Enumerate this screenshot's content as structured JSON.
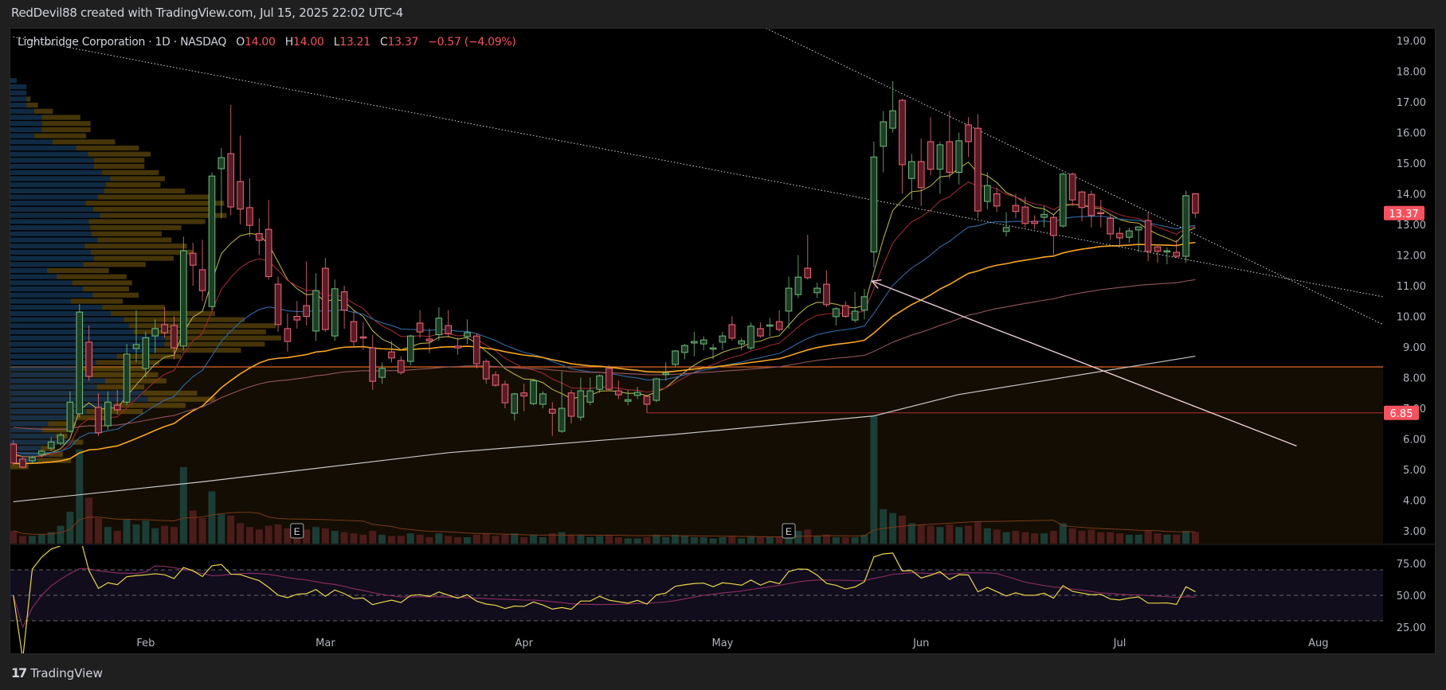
{
  "header": {
    "attribution": "RedDevil88 created with TradingView.com, Jul 15, 2025 22:02 UTC-4"
  },
  "legend": {
    "symbol": "Lightbridge Corporation · 1D · NASDAQ",
    "open_label": "O",
    "open": "14.00",
    "high_label": "H",
    "high": "14.00",
    "low_label": "L",
    "low": "13.21",
    "close_label": "C",
    "close": "13.37",
    "change": "−0.57 (−4.09%)"
  },
  "footer": {
    "logo_mark": "17",
    "brand": "TradingView"
  },
  "price_axis": [
    "19.00",
    "18.00",
    "17.00",
    "16.00",
    "15.00",
    "14.00",
    "13.00",
    "12.00",
    "11.00",
    "10.00",
    "9.00",
    "8.00",
    "7.00",
    "6.00",
    "5.00",
    "4.00",
    "3.00"
  ],
  "rsi_axis": [
    "75.00",
    "50.00",
    "25.00"
  ],
  "time_axis": [
    {
      "label": "Feb",
      "index": 14
    },
    {
      "label": "Mar",
      "index": 33
    },
    {
      "label": "Apr",
      "index": 54
    },
    {
      "label": "May",
      "index": 75
    },
    {
      "label": "Jun",
      "index": 96
    },
    {
      "label": "Jul",
      "index": 117
    },
    {
      "label": "Aug",
      "index": 138
    }
  ],
  "badges": {
    "last_price": "13.37",
    "level": "6.85"
  },
  "earnings_markers": [
    {
      "label": "E",
      "index": 30
    },
    {
      "label": "E",
      "index": 82
    }
  ],
  "colors": {
    "up": "#6fbf7b",
    "down": "#f06b7b",
    "badge": "#f7525f",
    "level_orange": "#e0662a",
    "level_red": "#b03030"
  },
  "chart_data": {
    "type": "candlestick",
    "title": "Lightbridge Corporation · 1D · NASDAQ",
    "ylim": [
      2.7,
      19.85
    ],
    "rsi_ylim": [
      0,
      100
    ],
    "ohlc": [
      [
        5.83,
        5.95,
        5.15,
        5.21
      ],
      [
        5.34,
        5.4,
        5.05,
        5.08
      ],
      [
        5.29,
        5.45,
        5.2,
        5.39
      ],
      [
        5.5,
        5.65,
        5.4,
        5.6
      ],
      [
        5.7,
        6.05,
        5.6,
        5.9
      ],
      [
        5.86,
        6.2,
        5.8,
        6.12
      ],
      [
        6.25,
        7.55,
        6.2,
        7.2
      ],
      [
        6.82,
        10.4,
        6.7,
        10.14
      ],
      [
        9.16,
        9.7,
        7.9,
        8.04
      ],
      [
        7.03,
        7.5,
        6.1,
        6.2
      ],
      [
        6.43,
        7.55,
        6.3,
        7.2
      ],
      [
        7.1,
        7.6,
        6.8,
        6.95
      ],
      [
        7.2,
        9.1,
        7.1,
        8.77
      ],
      [
        8.95,
        10.2,
        8.5,
        9.08
      ],
      [
        8.3,
        9.5,
        8.0,
        9.3
      ],
      [
        9.36,
        9.9,
        8.8,
        9.6
      ],
      [
        9.73,
        10.3,
        9.3,
        9.47
      ],
      [
        9.7,
        10.0,
        8.6,
        8.97
      ],
      [
        9.03,
        12.6,
        8.9,
        12.14
      ],
      [
        12.06,
        12.4,
        11.0,
        11.67
      ],
      [
        11.52,
        12.5,
        10.5,
        10.84
      ],
      [
        10.32,
        14.7,
        10.2,
        14.58
      ],
      [
        14.82,
        15.5,
        13.2,
        15.18
      ],
      [
        15.31,
        16.9,
        13.3,
        13.57
      ],
      [
        14.4,
        15.9,
        13.0,
        13.5
      ],
      [
        13.55,
        14.5,
        12.6,
        12.97
      ],
      [
        12.7,
        13.2,
        12.0,
        12.48
      ],
      [
        12.84,
        13.8,
        11.2,
        11.3
      ],
      [
        11.05,
        11.3,
        9.5,
        9.73
      ],
      [
        9.6,
        10.1,
        8.85,
        9.18
      ],
      [
        10.0,
        10.5,
        9.6,
        9.88
      ],
      [
        10.35,
        11.8,
        9.7,
        10.0
      ],
      [
        9.52,
        11.4,
        9.2,
        10.84
      ],
      [
        11.57,
        11.9,
        9.5,
        9.57
      ],
      [
        9.36,
        11.2,
        9.2,
        10.9
      ],
      [
        10.8,
        11.0,
        9.6,
        10.2
      ],
      [
        9.83,
        10.2,
        9.0,
        9.18
      ],
      [
        9.33,
        9.8,
        8.9,
        9.3
      ],
      [
        8.97,
        9.4,
        7.6,
        7.88
      ],
      [
        8.01,
        8.5,
        7.8,
        8.3
      ],
      [
        8.84,
        9.2,
        8.5,
        8.64
      ],
      [
        8.56,
        8.7,
        8.1,
        8.17
      ],
      [
        8.53,
        9.4,
        8.4,
        9.36
      ],
      [
        9.78,
        10.2,
        9.3,
        9.49
      ],
      [
        9.26,
        9.6,
        8.8,
        9.2
      ],
      [
        9.4,
        10.3,
        9.2,
        9.94
      ],
      [
        9.7,
        10.2,
        9.3,
        9.44
      ],
      [
        9.03,
        9.3,
        8.75,
        8.97
      ],
      [
        9.34,
        9.9,
        9.1,
        9.47
      ],
      [
        9.36,
        9.45,
        8.3,
        8.45
      ],
      [
        8.53,
        8.6,
        7.8,
        7.96
      ],
      [
        8.09,
        8.2,
        7.7,
        7.75
      ],
      [
        7.78,
        7.9,
        7.0,
        7.18
      ],
      [
        6.84,
        7.5,
        6.6,
        7.47
      ],
      [
        7.5,
        7.8,
        6.9,
        7.4
      ],
      [
        7.15,
        7.95,
        7.1,
        7.9
      ],
      [
        7.13,
        7.55,
        7.0,
        7.47
      ],
      [
        6.97,
        7.2,
        6.1,
        6.84
      ],
      [
        6.25,
        8.2,
        6.2,
        7.0
      ],
      [
        7.5,
        7.6,
        6.5,
        6.74
      ],
      [
        6.71,
        8.0,
        6.6,
        7.57
      ],
      [
        7.2,
        8.0,
        7.1,
        7.57
      ],
      [
        7.62,
        8.1,
        7.5,
        8.06
      ],
      [
        8.3,
        8.4,
        7.6,
        7.62
      ],
      [
        7.57,
        7.9,
        7.3,
        7.44
      ],
      [
        7.23,
        7.6,
        7.1,
        7.28
      ],
      [
        7.42,
        7.7,
        7.3,
        7.52
      ],
      [
        7.39,
        7.4,
        6.85,
        7.13
      ],
      [
        7.26,
        8.0,
        7.2,
        7.96
      ],
      [
        8.1,
        8.5,
        7.9,
        8.15
      ],
      [
        8.43,
        8.9,
        8.35,
        8.87
      ],
      [
        8.82,
        9.1,
        8.6,
        9.05
      ],
      [
        9.13,
        9.5,
        8.7,
        9.18
      ],
      [
        9.1,
        9.35,
        8.9,
        9.23
      ],
      [
        8.95,
        9.1,
        8.6,
        8.97
      ],
      [
        9.16,
        9.5,
        8.9,
        9.36
      ],
      [
        9.73,
        10.0,
        9.2,
        9.29
      ],
      [
        9.1,
        9.3,
        8.9,
        9.2
      ],
      [
        8.97,
        9.8,
        8.9,
        9.68
      ],
      [
        9.6,
        9.8,
        9.3,
        9.36
      ],
      [
        9.68,
        9.95,
        9.35,
        9.72
      ],
      [
        9.83,
        10.2,
        9.5,
        9.57
      ],
      [
        10.17,
        11.3,
        9.6,
        10.92
      ],
      [
        10.71,
        12.0,
        10.6,
        11.28
      ],
      [
        11.57,
        12.66,
        11.2,
        11.26
      ],
      [
        10.77,
        11.1,
        10.6,
        10.92
      ],
      [
        11.05,
        11.5,
        10.3,
        10.38
      ],
      [
        9.99,
        10.3,
        9.7,
        10.25
      ],
      [
        10.35,
        10.5,
        9.95,
        10.0
      ],
      [
        9.88,
        10.8,
        9.8,
        10.17
      ],
      [
        10.2,
        10.9,
        9.9,
        10.64
      ],
      [
        12.1,
        15.7,
        11.6,
        15.2
      ],
      [
        15.55,
        16.7,
        14.7,
        16.35
      ],
      [
        16.14,
        17.68,
        16.0,
        16.71
      ],
      [
        17.05,
        17.1,
        14.0,
        14.95
      ],
      [
        14.5,
        15.3,
        13.8,
        15.05
      ],
      [
        15.05,
        15.8,
        13.6,
        14.2
      ],
      [
        15.7,
        16.5,
        14.6,
        14.8
      ],
      [
        14.8,
        15.7,
        14.0,
        15.6
      ],
      [
        15.7,
        16.7,
        14.5,
        14.7
      ],
      [
        14.7,
        16.0,
        14.3,
        15.73
      ],
      [
        16.25,
        16.5,
        15.2,
        15.7
      ],
      [
        16.14,
        16.6,
        13.2,
        13.44
      ],
      [
        13.75,
        14.7,
        13.5,
        14.27
      ],
      [
        14.0,
        14.2,
        13.4,
        13.6
      ],
      [
        12.77,
        13.4,
        12.6,
        12.9
      ],
      [
        13.62,
        14.0,
        13.2,
        13.42
      ],
      [
        13.57,
        13.9,
        12.9,
        13.03
      ],
      [
        13.1,
        13.3,
        12.85,
        13.03
      ],
      [
        13.23,
        13.6,
        12.9,
        13.33
      ],
      [
        13.23,
        13.3,
        12.0,
        12.64
      ],
      [
        12.95,
        14.7,
        12.9,
        14.64
      ],
      [
        14.64,
        14.7,
        13.6,
        13.8
      ],
      [
        14.06,
        14.1,
        13.1,
        13.55
      ],
      [
        13.98,
        14.1,
        12.9,
        13.29
      ],
      [
        13.39,
        13.8,
        12.9,
        13.37
      ],
      [
        13.2,
        13.3,
        12.5,
        12.69
      ],
      [
        12.71,
        12.9,
        12.3,
        12.56
      ],
      [
        12.58,
        12.9,
        12.4,
        12.79
      ],
      [
        12.82,
        12.9,
        12.1,
        12.92
      ],
      [
        13.13,
        13.4,
        11.8,
        12.12
      ],
      [
        12.27,
        12.3,
        11.75,
        12.12
      ],
      [
        12.1,
        12.25,
        11.7,
        12.14
      ],
      [
        12.09,
        12.5,
        11.9,
        11.96
      ],
      [
        11.96,
        14.1,
        11.75,
        13.94
      ],
      [
        14.0,
        14.0,
        13.21,
        13.37
      ]
    ],
    "volume_millions": [
      1.0,
      0.6,
      0.6,
      0.7,
      0.9,
      1.4,
      2.5,
      7.4,
      3.6,
      2.0,
      1.3,
      1.0,
      1.9,
      1.5,
      1.8,
      1.2,
      1.4,
      1.3,
      6.0,
      2.6,
      2.0,
      4.1,
      2.3,
      2.2,
      1.6,
      1.3,
      1.1,
      1.4,
      1.5,
      1.2,
      1.0,
      1.1,
      1.3,
      1.2,
      1.0,
      0.9,
      0.8,
      0.7,
      1.0,
      0.7,
      0.6,
      0.6,
      0.8,
      0.7,
      0.5,
      0.8,
      0.6,
      0.5,
      0.5,
      0.7,
      0.8,
      0.6,
      0.7,
      0.8,
      0.5,
      0.7,
      0.5,
      0.8,
      0.9,
      0.7,
      0.7,
      0.5,
      0.6,
      0.7,
      0.5,
      0.4,
      0.4,
      0.5,
      0.7,
      0.5,
      0.7,
      0.6,
      0.5,
      0.5,
      0.4,
      0.5,
      0.6,
      0.4,
      0.6,
      0.5,
      0.5,
      0.5,
      0.9,
      1.0,
      1.1,
      0.6,
      0.7,
      0.5,
      0.5,
      0.5,
      0.7,
      10.0,
      2.7,
      2.4,
      2.2,
      1.6,
      1.5,
      1.4,
      1.3,
      1.5,
      1.3,
      1.4,
      1.7,
      1.2,
      1.1,
      0.9,
      1.0,
      0.9,
      0.8,
      0.8,
      1.0,
      1.6,
      1.2,
      1.0,
      1.1,
      0.9,
      0.9,
      0.8,
      0.7,
      0.7,
      1.0,
      0.8,
      0.7,
      0.7,
      1.0,
      0.9
    ],
    "moving_averages": [
      {
        "type": "ema",
        "period": 8,
        "seed": 5.6,
        "color": "#b5ad45"
      },
      {
        "type": "ema",
        "period": 13,
        "seed": 5.5,
        "color": "#9c2a32"
      },
      {
        "type": "ema",
        "period": 26,
        "seed": 5.6,
        "color": "#2f6aa6"
      },
      {
        "type": "ema",
        "period": 50,
        "seed": 5.2,
        "color": "#f5a623"
      },
      {
        "type": "ema",
        "period": 100,
        "seed": 6.4,
        "color": "#94565c"
      }
    ],
    "long_ma_points": [
      [
        0,
        3.95
      ],
      [
        20,
        4.6
      ],
      [
        46,
        5.55
      ],
      [
        70,
        6.15
      ],
      [
        91,
        6.75
      ],
      [
        100,
        7.45
      ],
      [
        125,
        8.7
      ]
    ],
    "horizontal_levels": [
      {
        "price": 8.35,
        "from_index": 0
      },
      {
        "price": 6.85,
        "from_index": 67
      }
    ],
    "trendlines": [
      {
        "from": [
          0,
          19.12
        ],
        "to": [
          144.8,
          10.64
        ]
      },
      {
        "from": [
          79.6,
          19.4
        ],
        "to": [
          144.8,
          9.74
        ]
      }
    ],
    "arrow": {
      "from": [
        135.7,
        5.77
      ],
      "to": [
        90.8,
        11.15
      ]
    },
    "rsi": {
      "period": 14,
      "ma_period": 14,
      "upper": 70,
      "middle": 50,
      "lower": 30
    }
  }
}
